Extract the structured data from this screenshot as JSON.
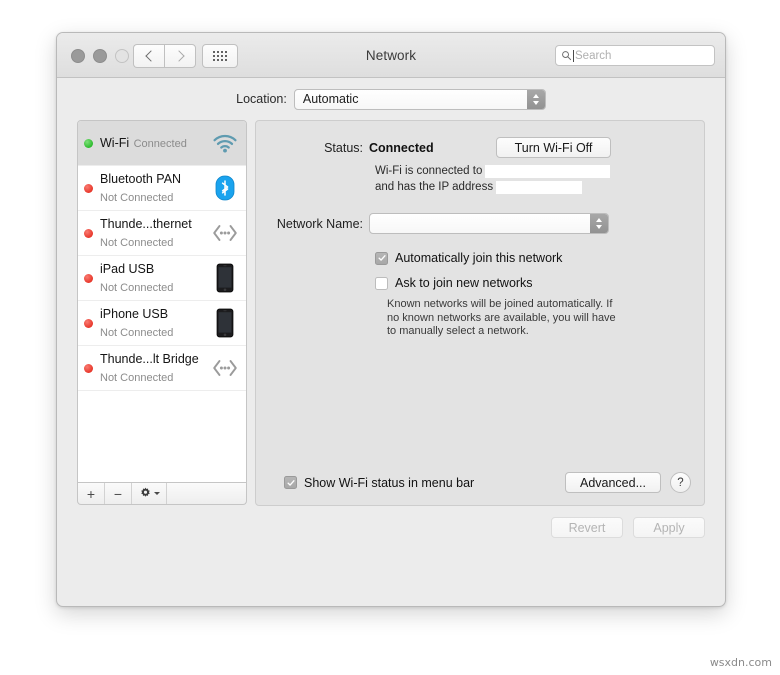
{
  "window": {
    "title": "Network",
    "traffic_lights": [
      "close",
      "minimize",
      "zoom"
    ],
    "nav": {
      "back": "back-chevron",
      "forward": "forward-chevron",
      "grid": "show-all-grid"
    },
    "search": {
      "placeholder": "Search",
      "value": ""
    }
  },
  "location": {
    "label": "Location:",
    "value": "Automatic"
  },
  "services": [
    {
      "name": "Wi-Fi",
      "status": "Connected",
      "dot": "green",
      "icon": "wifi-icon",
      "selected": true
    },
    {
      "name": "Bluetooth PAN",
      "status": "Not Connected",
      "dot": "red",
      "icon": "bluetooth-icon",
      "selected": false
    },
    {
      "name": "Thunde...thernet",
      "status": "Not Connected",
      "dot": "red",
      "icon": "thunderbolt-icon",
      "selected": false
    },
    {
      "name": "iPad USB",
      "status": "Not Connected",
      "dot": "red",
      "icon": "ipad-icon",
      "selected": false
    },
    {
      "name": "iPhone USB",
      "status": "Not Connected",
      "dot": "red",
      "icon": "iphone-icon",
      "selected": false
    },
    {
      "name": "Thunde...lt Bridge",
      "status": "Not Connected",
      "dot": "red",
      "icon": "thunderbolt-icon",
      "selected": false
    }
  ],
  "service_toolbar": {
    "add": "+",
    "remove": "−",
    "actions": "gear-icon"
  },
  "detail": {
    "status_label": "Status:",
    "status_value": "Connected",
    "turn_off_button": "Turn Wi-Fi Off",
    "connected_to_text": "Wi-Fi is connected to",
    "ip_address_text": "and has the IP address",
    "connected_network_redacted": "",
    "ip_address_redacted": "",
    "network_name_label": "Network Name:",
    "network_name_value": "",
    "auto_join": {
      "label": "Automatically join this network",
      "checked": true
    },
    "ask_join": {
      "label": "Ask to join new networks",
      "checked": false
    },
    "hint": "Known networks will be joined automatically. If no known networks are available, you will have to manually select a network.",
    "show_status": {
      "label": "Show Wi-Fi status in menu bar",
      "checked": true
    },
    "advanced_button": "Advanced...",
    "help_button": "?"
  },
  "footer": {
    "revert": "Revert",
    "apply": "Apply"
  },
  "watermark": "wsxdn.com",
  "colors": {
    "window_bg": "#ececec",
    "panel_bg": "#e3e3e3",
    "selected_row": "#dcdcdc",
    "status_connected_dot": "#2dbb2d",
    "status_disconnected_dot": "#e8372a",
    "bluetooth_blue": "#18a0e8",
    "wifi_teal": "#5f9bb0"
  }
}
